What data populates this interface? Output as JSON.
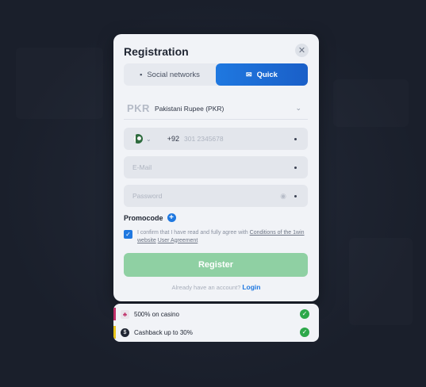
{
  "modal": {
    "title": "Registration",
    "close_symbol": "✕"
  },
  "tabs": [
    {
      "label": "Social networks",
      "icon": "chat-icon",
      "active": false
    },
    {
      "label": "Quick",
      "icon": "envelope-icon",
      "active": true
    }
  ],
  "currency": {
    "code": "PKR",
    "name": "Pakistani Rupee (PKR)"
  },
  "phone": {
    "country": "Pakistan",
    "dial_code": "+92",
    "placeholder": "301 2345678"
  },
  "email": {
    "placeholder": "E-Mail"
  },
  "password": {
    "placeholder": "Password"
  },
  "promocode": {
    "label": "Promocode"
  },
  "agreement": {
    "checked": true,
    "text": "I confirm that I have read and fully agree with",
    "link1": "Conditions of the 1win website",
    "link2": "User Agreement"
  },
  "register": {
    "label": "Register",
    "color": "#8fd0a3"
  },
  "login": {
    "prompt": "Already have an account?",
    "link": "Login"
  },
  "bonuses": [
    {
      "text": "500% on casino",
      "icon": "casino-icon",
      "accent": "#c0306a"
    },
    {
      "text": "Cashback up to 30%",
      "icon": "cashback-icon",
      "accent": "#e8c41a"
    }
  ],
  "colors": {
    "accent": "#1f78e0",
    "success": "#2da84a",
    "background": "#1b202c"
  }
}
